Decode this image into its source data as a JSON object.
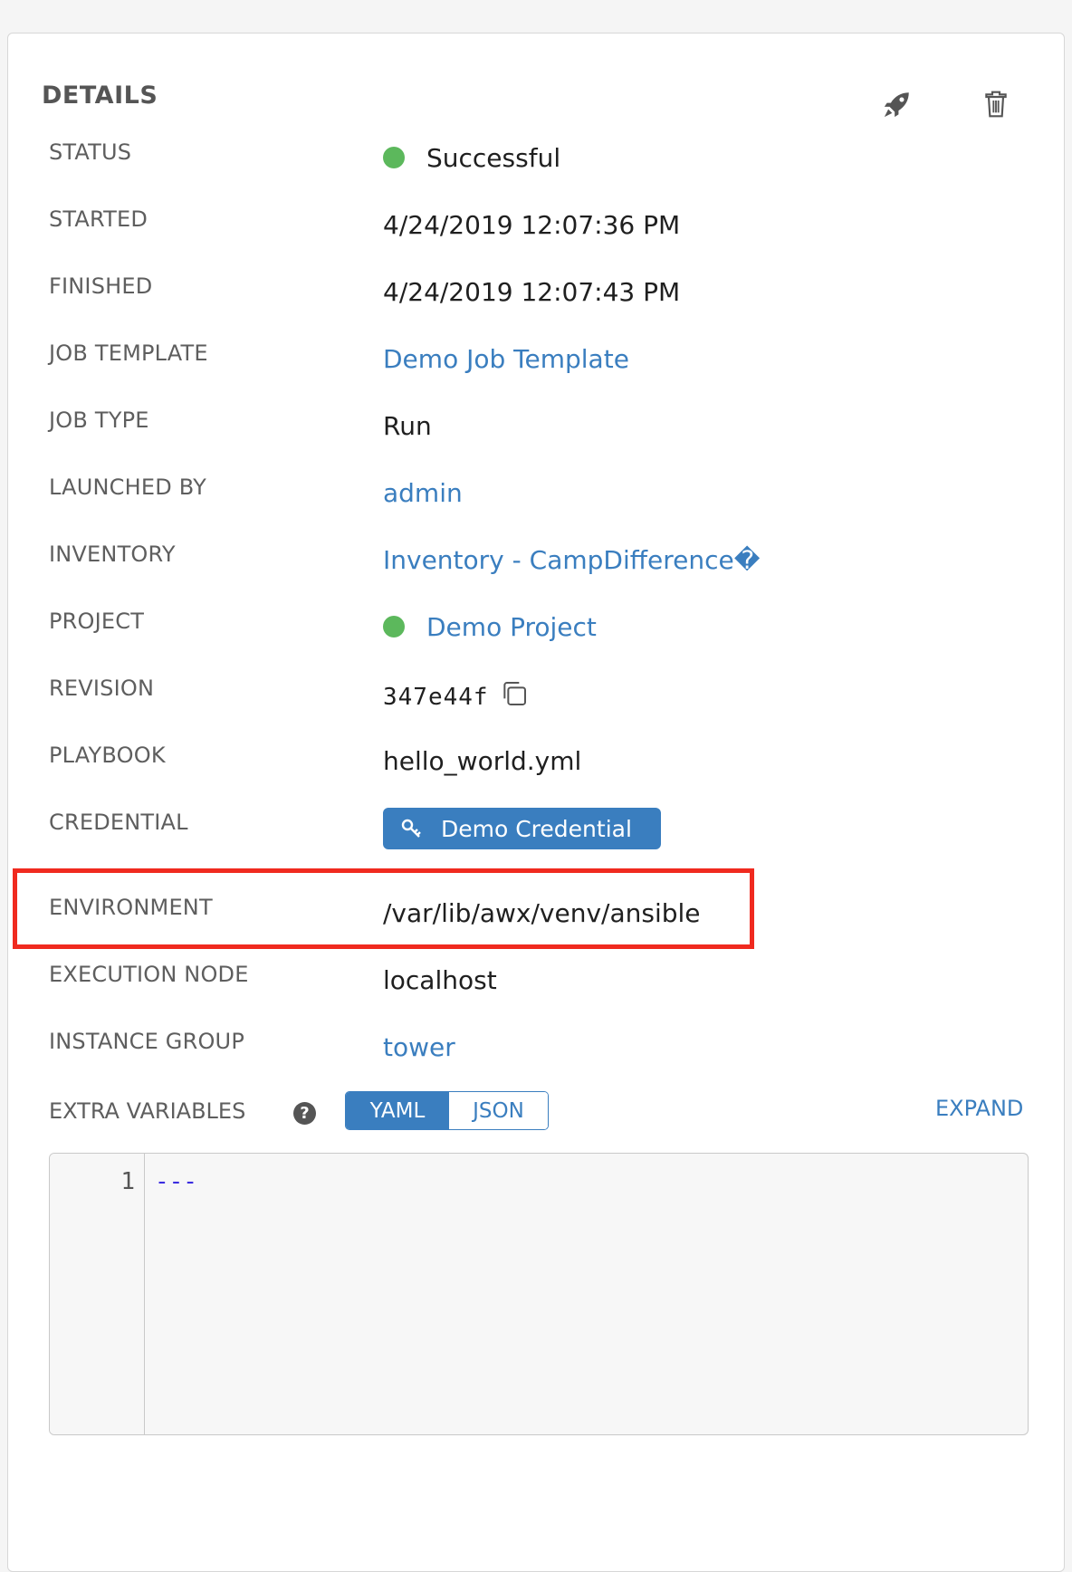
{
  "details": {
    "title": "DETAILS",
    "launch_icon": "rocket-icon",
    "delete_icon": "trash-icon",
    "status": {
      "label": "STATUS",
      "value": "Successful",
      "color": "#5cb85c"
    },
    "started": {
      "label": "STARTED",
      "value": "4/24/2019 12:07:36 PM"
    },
    "finished": {
      "label": "FINISHED",
      "value": "4/24/2019 12:07:43 PM"
    },
    "job_template": {
      "label": "JOB TEMPLATE",
      "value": "Demo Job Template"
    },
    "job_type": {
      "label": "JOB TYPE",
      "value": "Run"
    },
    "launched_by": {
      "label": "LAUNCHED BY",
      "value": "admin"
    },
    "inventory": {
      "label": "INVENTORY",
      "value": "Inventory - CampDifference�"
    },
    "project": {
      "label": "PROJECT",
      "value": "Demo Project",
      "color": "#5cb85c"
    },
    "revision": {
      "label": "REVISION",
      "value": "347e44f",
      "copy_icon": "copy-icon"
    },
    "playbook": {
      "label": "PLAYBOOK",
      "value": "hello_world.yml"
    },
    "credential": {
      "label": "CREDENTIAL",
      "value": "Demo Credential",
      "icon": "key-icon"
    },
    "environment": {
      "label": "ENVIRONMENT",
      "value": "/var/lib/awx/venv/ansible",
      "highlight_color": "#f02a1f"
    },
    "execution_node": {
      "label": "EXECUTION NODE",
      "value": "localhost"
    },
    "instance_group": {
      "label": "INSTANCE GROUP",
      "value": "tower"
    }
  },
  "extra_variables": {
    "label": "EXTRA VARIABLES",
    "help_icon": "question-circle-icon",
    "help_glyph": "?",
    "modes": [
      "YAML",
      "JSON"
    ],
    "active_mode": "YAML",
    "expand_label": "EXPAND",
    "editor": {
      "line_number": "1",
      "content": "---"
    }
  },
  "colors": {
    "accent": "#3a7ebf",
    "success": "#5cb85c",
    "highlight": "#f02a1f"
  }
}
